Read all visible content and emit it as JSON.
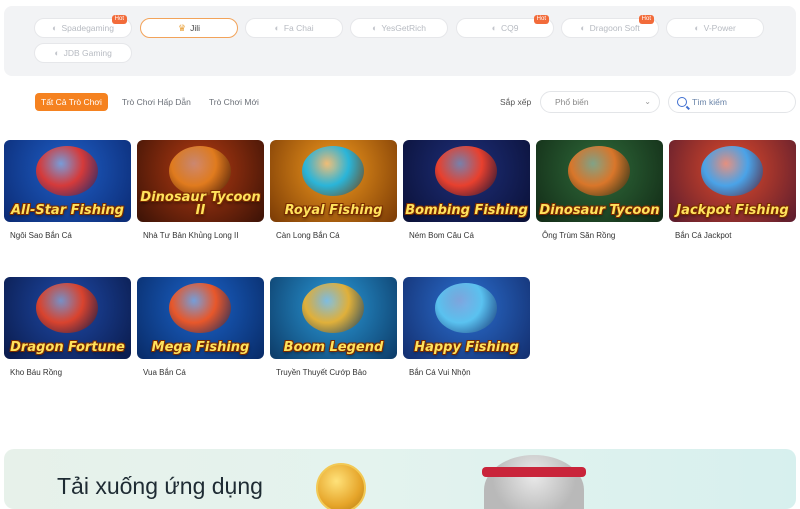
{
  "providers": [
    {
      "label": "Spadegaming",
      "icon": "spade-icon",
      "hot": true,
      "active": false
    },
    {
      "label": "Jili",
      "icon": "crown-icon",
      "hot": false,
      "active": true
    },
    {
      "label": "Fa Chai",
      "icon": "fachai-icon",
      "hot": false,
      "active": false
    },
    {
      "label": "YesGetRich",
      "icon": "ygr-icon",
      "hot": false,
      "active": false
    },
    {
      "label": "CQ9",
      "icon": "cq9-icon",
      "hot": true,
      "active": false
    },
    {
      "label": "Dragoon Soft",
      "icon": "dragon-icon",
      "hot": true,
      "active": false
    },
    {
      "label": "V-Power",
      "icon": "vpower-icon",
      "hot": false,
      "active": false
    },
    {
      "label": "JDB Gaming",
      "icon": "jdb-icon",
      "hot": false,
      "active": false
    }
  ],
  "hot_label": "Hot",
  "tabs": [
    {
      "label": "Tất Cả Trò Chơi",
      "active": true
    },
    {
      "label": "Trò Chơi Hấp Dẫn",
      "active": false
    },
    {
      "label": "Trò Chơi Mới",
      "active": false
    }
  ],
  "sort": {
    "label": "Sắp xếp",
    "value": "Phổ biến"
  },
  "search": {
    "placeholder": "Tìm kiếm",
    "value": ""
  },
  "games": [
    {
      "name": "Ngôi Sao Bắn Cá",
      "title": "All-Star Fishing",
      "bg1": "#1f5fc7",
      "bg2": "#0b2a73",
      "art": "#d53a3a"
    },
    {
      "name": "Nhà Tư Bản Khủng Long II",
      "title": "Dinosaur Tycoon II",
      "bg1": "#b53b12",
      "bg2": "#3a1206",
      "art": "#e07b1e"
    },
    {
      "name": "Càn Long Bắn Cá",
      "title": "Royal Fishing",
      "bg1": "#f29a1e",
      "bg2": "#7a3a05",
      "art": "#2ab5d9"
    },
    {
      "name": "Ném Bom Câu Cá",
      "title": "Bombing Fishing",
      "bg1": "#1e2f7a",
      "bg2": "#0a1036",
      "art": "#e8402e"
    },
    {
      "name": "Ông Trùm Săn Rồng",
      "title": "Dinosaur Tycoon",
      "bg1": "#2f6b3a",
      "bg2": "#122a16",
      "art": "#d9762a"
    },
    {
      "name": "Bắn Cá Jackpot",
      "title": "Jackpot Fishing",
      "bg1": "#e04a2a",
      "bg2": "#5a1c2e",
      "art": "#4aa3e8"
    },
    {
      "name": "Kho Báu Rồng",
      "title": "Dragon Fortune",
      "bg1": "#1e4aa8",
      "bg2": "#0a1a4a",
      "art": "#d9432e"
    },
    {
      "name": "Vua Bắn Cá",
      "title": "Mega Fishing",
      "bg1": "#1b63c9",
      "bg2": "#082a66",
      "art": "#e8572a"
    },
    {
      "name": "Truyền Thuyết Cướp Bảo",
      "title": "Boom Legend",
      "bg1": "#2a9ad9",
      "bg2": "#0c3a66",
      "art": "#e0b03a"
    },
    {
      "name": "Bắn Cá Vui Nhộn",
      "title": "Happy Fishing",
      "bg1": "#2b6fd0",
      "bg2": "#132e6e",
      "art": "#5ac2f0"
    }
  ],
  "banner": {
    "title": "Tải xuống ứng dụng"
  }
}
